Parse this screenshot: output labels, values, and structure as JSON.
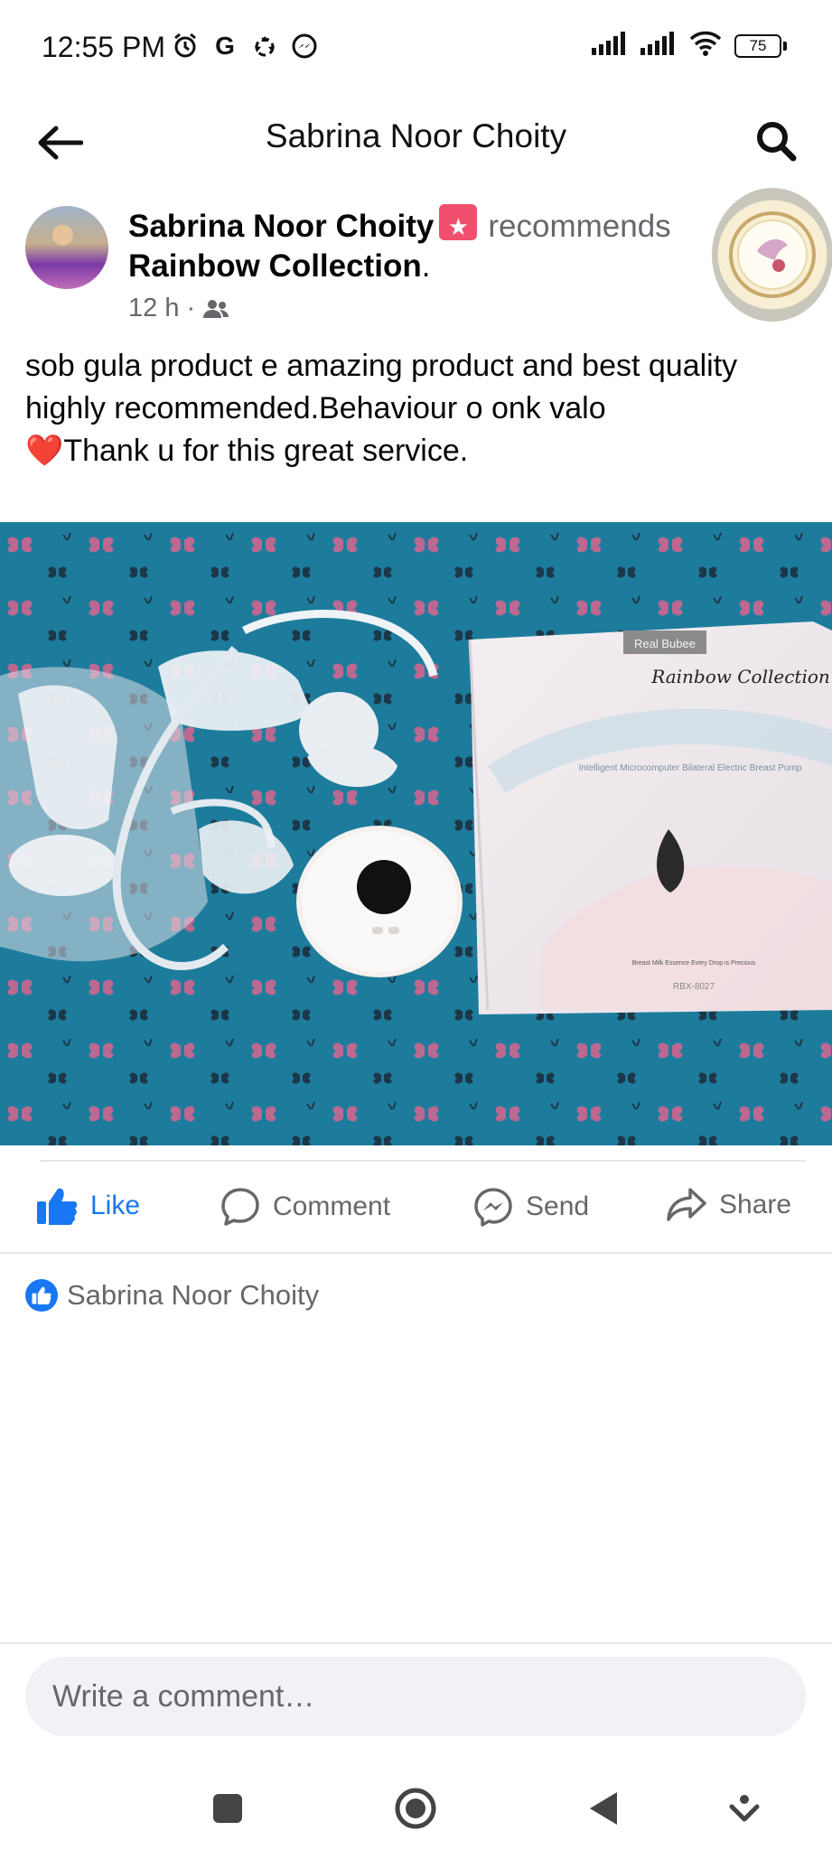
{
  "status_bar": {
    "time": "12:55 PM",
    "battery": "75"
  },
  "header": {
    "title": "Sabrina Noor Choity"
  },
  "post": {
    "author": "Sabrina Noor Choity",
    "verb": "recommends",
    "page": "Rainbow Collection",
    "page_suffix": ".",
    "time": "12 h",
    "audience_separator": "·",
    "text_line1": "sob gula product e amazing product and best quality highly recommended.Behaviour o onk valo",
    "text_heart": "❤️",
    "text_line2": "Thank u for this great service.",
    "photo": {
      "box_brand": "Real Bubee",
      "box_handwriting": "Rainbow Collection",
      "box_product": "Intelligent Microcomputer Bilateral Electric Breast Pump",
      "box_tagline": "Breast Milk Essence Every Drop is Precious",
      "box_model": "RBX-8027"
    }
  },
  "actions": {
    "like": "Like",
    "comment": "Comment",
    "send": "Send",
    "share": "Share"
  },
  "reactions": {
    "names": "Sabrina Noor Choity"
  },
  "comment_box": {
    "placeholder": "Write a comment…"
  },
  "colors": {
    "accent": "#1877f2",
    "secondary_text": "#65676b",
    "background": "#ffffff"
  }
}
